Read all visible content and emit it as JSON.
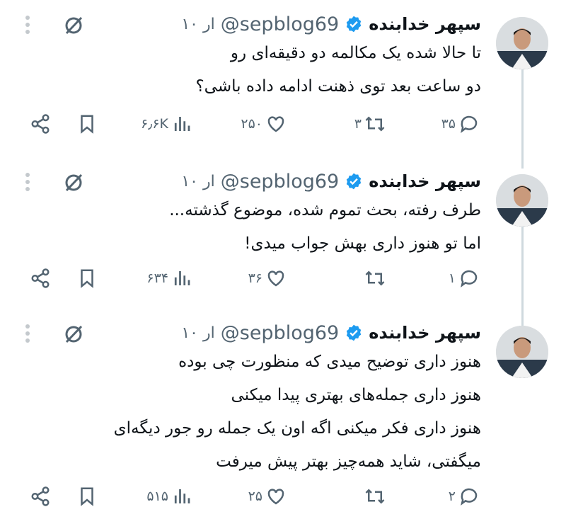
{
  "tweets": [
    {
      "name": "سپهر خدابنده",
      "handle": "@sepblog69",
      "time": "۱۰ ار",
      "text": "تا حالا شده یک مکالمه دو دقیقه‌ای رو\nدو ساعت بعد توی ذهنت ادامه داده باشی؟",
      "replies": "۳۵",
      "retweets": "۳",
      "likes": "۲۵۰",
      "views": "۶٫۶K"
    },
    {
      "name": "سپهر خدابنده",
      "handle": "@sepblog69",
      "time": "۱۰ ار",
      "text": "طرف رفته، بحث تموم شده، موضوع گذشته...\nاما تو هنوز داری بهش جواب میدی!",
      "replies": "۱",
      "retweets": "",
      "likes": "۳۶",
      "views": "۶۳۴"
    },
    {
      "name": "سپهر خدابنده",
      "handle": "@sepblog69",
      "time": "۱۰ ار",
      "text": "هنوز داری توضیح میدی که منظورت چی بوده\nهنوز داری جمله‌های بهتری پیدا میکنی\nهنوز داری فکر میکنی اگه اون یک جمله رو جور دیگه‌ای\nمیگفتی، شاید همه‌چیز بهتر پیش میرفت",
      "replies": "۲",
      "retweets": "",
      "likes": "۲۵",
      "views": "۵۱۵"
    }
  ],
  "icons": {
    "verified": "verified-badge-icon",
    "grok": "grok-icon",
    "more": "more-options-icon",
    "reply": "reply-icon",
    "retweet": "retweet-icon",
    "like": "like-icon",
    "views": "views-icon",
    "bookmark": "bookmark-icon",
    "share": "share-icon"
  },
  "colors": {
    "accent": "#1d9bf0",
    "muted": "#536471",
    "text": "#0f1419"
  }
}
